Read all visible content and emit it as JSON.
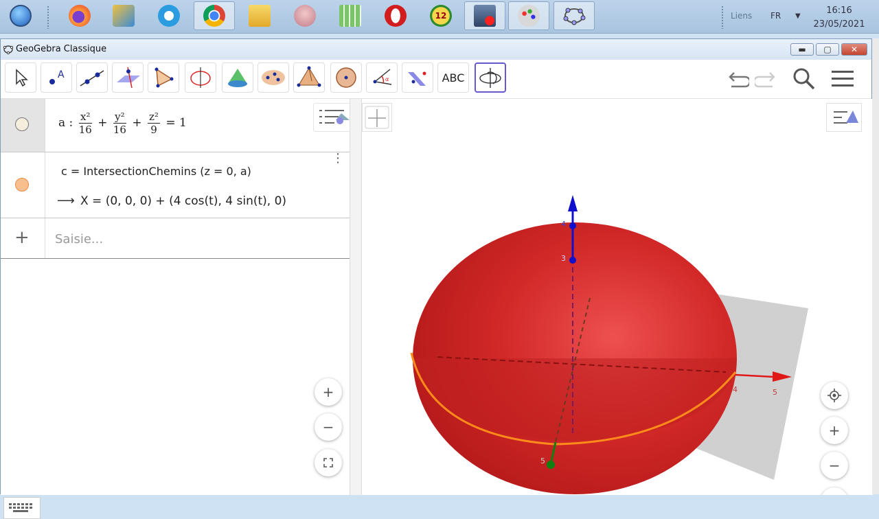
{
  "taskbar": {
    "apps": [
      {
        "name": "start",
        "color": "#2a66c9"
      },
      {
        "name": "firefox",
        "color": "#e8612c"
      },
      {
        "name": "tools",
        "color": "#3a8bd8"
      },
      {
        "name": "ie",
        "color": "#2b9ce0"
      },
      {
        "name": "chrome",
        "color": "#4caf50"
      },
      {
        "name": "folder",
        "color": "#f2c84b"
      },
      {
        "name": "paint-brain",
        "color": "#d9a0a0"
      },
      {
        "name": "calc",
        "color": "#5aa84a"
      },
      {
        "name": "opera",
        "color": "#d11d1d"
      },
      {
        "name": "clock12",
        "color": "#e8b41a"
      },
      {
        "name": "video",
        "color": "#5d7aa0"
      },
      {
        "name": "paint",
        "color": "#b9b9b9"
      },
      {
        "name": "geogebra",
        "color": "#6a6a9a"
      }
    ],
    "tray_links": "Liens",
    "tray_lang": "FR",
    "time": "16:16",
    "date": "23/05/2021"
  },
  "window": {
    "title": "GeoGebra Classique",
    "min_label": "▬",
    "max_label": "▢",
    "close_label": "✕"
  },
  "toolbar": {
    "text_tool_label": "ABC",
    "tools": [
      "move",
      "point",
      "line",
      "perpendicular",
      "polygon",
      "circle-axis",
      "pyramid",
      "sphere-points",
      "prism-net",
      "sphere",
      "angle",
      "reflect",
      "text",
      "rotate-view"
    ]
  },
  "algebra": {
    "row_a": {
      "name": "a",
      "num1": "x²",
      "den1": "16",
      "num2": "y²",
      "den2": "16",
      "num3": "z²",
      "den3": "9",
      "rhs": "1",
      "dot_color": "#f5eedd"
    },
    "row_c": {
      "definition": "c = IntersectionChemins (z = 0, a)",
      "value": "X = (0, 0, 0) + (4 cos(t), 4 sin(t), 0)",
      "dot_color": "#f7be8e"
    },
    "input_placeholder": "Saisie..."
  },
  "graphics": {
    "axis_labels": {
      "z4": "4",
      "z3": "3",
      "x4": "4",
      "x5": "5",
      "y5": "5"
    },
    "colors": {
      "sphere": "#cc2020",
      "z_axis": "#1010cc",
      "x_axis": "#e01818",
      "y_axis": "#108010",
      "curve": "#ff8c1a"
    }
  }
}
